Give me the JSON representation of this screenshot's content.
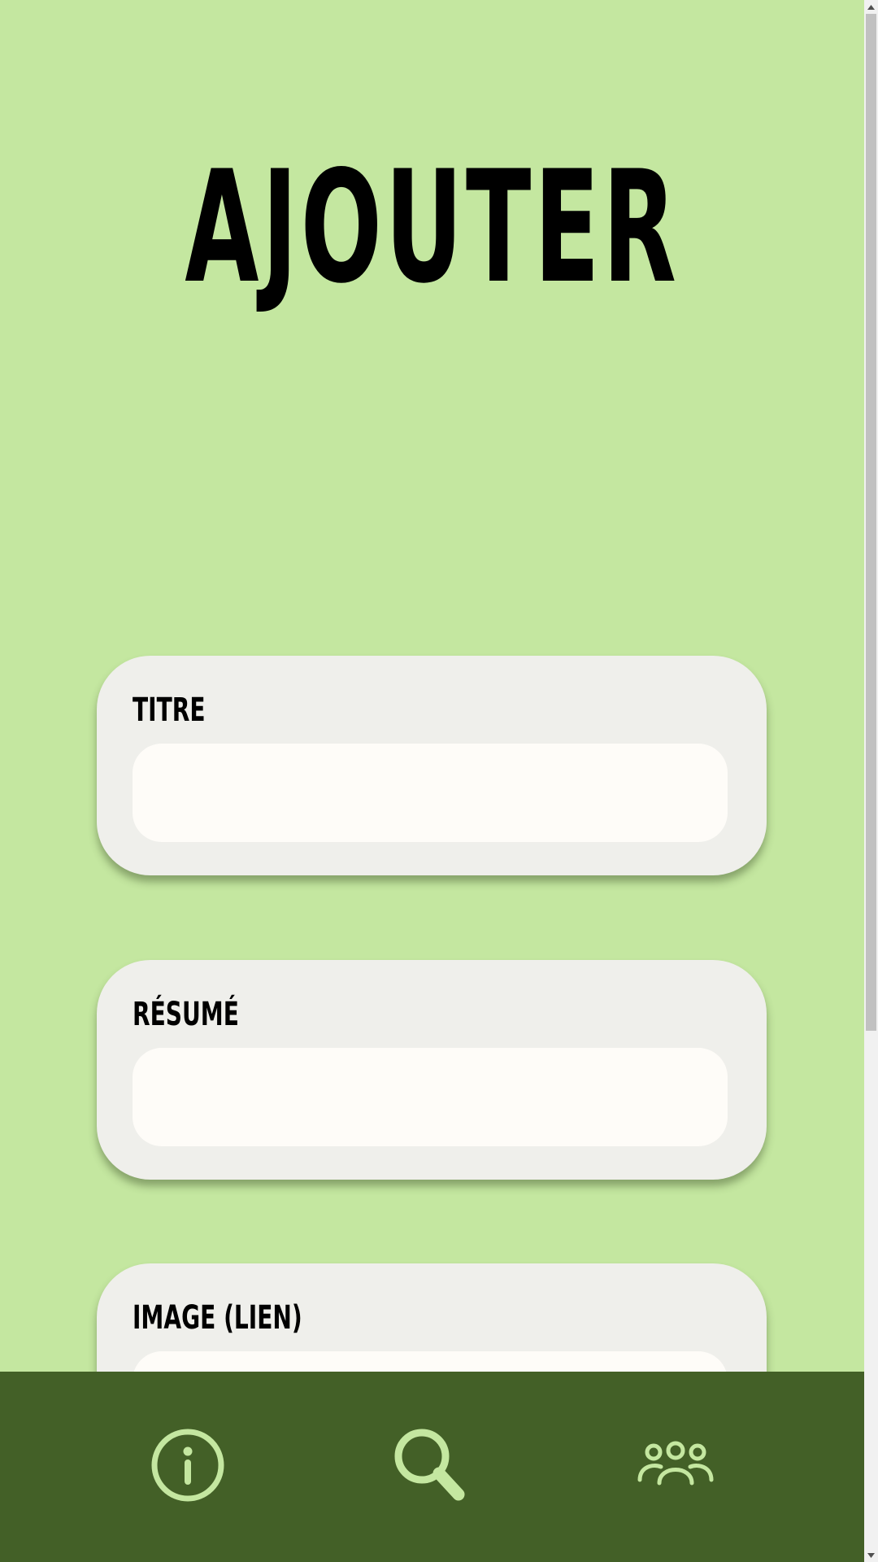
{
  "page": {
    "title": "AJOUTER"
  },
  "form": {
    "fields": [
      {
        "label": "TITRE",
        "value": "",
        "placeholder": ""
      },
      {
        "label": "RÉSUMÉ",
        "value": "",
        "placeholder": ""
      },
      {
        "label": "IMAGE (LIEN)",
        "value": "",
        "placeholder": ""
      }
    ]
  },
  "nav": {
    "items": [
      {
        "icon": "info-icon"
      },
      {
        "icon": "search-icon"
      },
      {
        "icon": "users-group-icon"
      }
    ]
  },
  "colors": {
    "background": "#c4e7a0",
    "card": "#efefeb",
    "input": "#fefcf8",
    "nav_bar": "#436027",
    "nav_icon": "#c4e7a0"
  }
}
